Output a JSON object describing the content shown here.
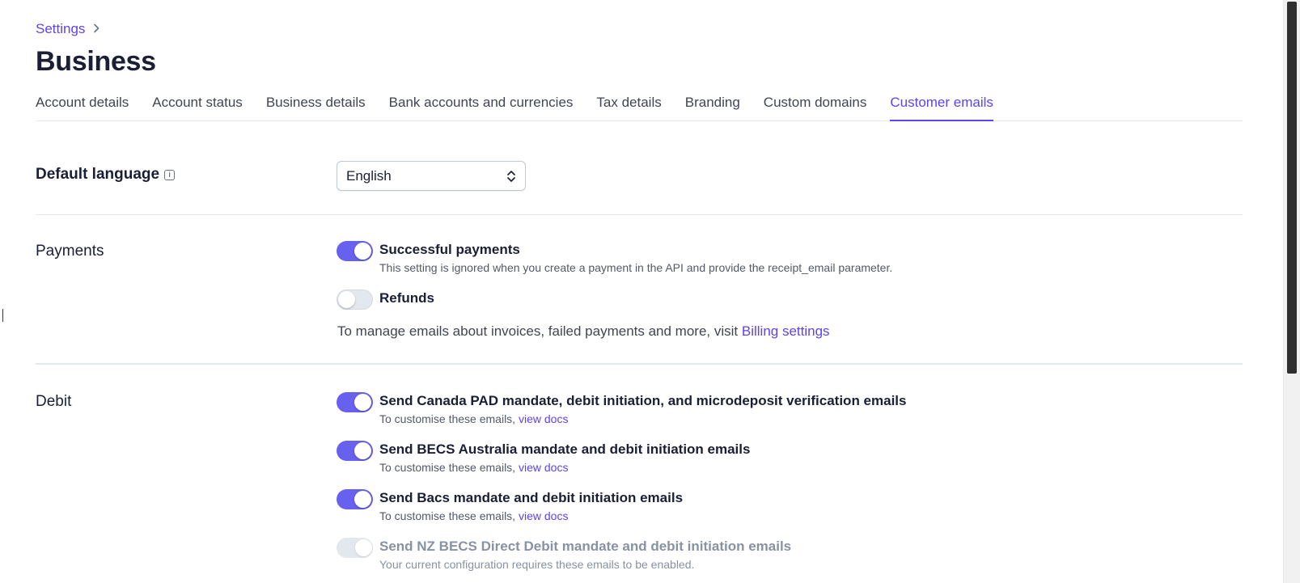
{
  "breadcrumb": {
    "link": "Settings",
    "sep_icon": "chevron-right-icon"
  },
  "page": {
    "title": "Business"
  },
  "tabs": [
    {
      "label": "Account details",
      "active": false
    },
    {
      "label": "Account status",
      "active": false
    },
    {
      "label": "Business details",
      "active": false
    },
    {
      "label": "Bank accounts and currencies",
      "active": false
    },
    {
      "label": "Tax details",
      "active": false
    },
    {
      "label": "Branding",
      "active": false
    },
    {
      "label": "Custom domains",
      "active": false
    },
    {
      "label": "Customer emails",
      "active": true
    }
  ],
  "default_language": {
    "label": "Default language",
    "info_icon": "info-icon",
    "selected": "English"
  },
  "payments": {
    "label": "Payments",
    "items": [
      {
        "title": "Successful payments",
        "desc": "This setting is ignored when you create a payment in the API and provide the receipt_email parameter.",
        "enabled": true
      },
      {
        "title": "Refunds",
        "desc": "",
        "enabled": false
      }
    ],
    "manage_text": "To manage emails about invoices, failed payments and more, visit ",
    "manage_link": "Billing settings"
  },
  "debit": {
    "label": "Debit",
    "items": [
      {
        "title": "Send Canada PAD mandate, debit initiation, and microdeposit verification emails",
        "desc": "To customise these emails, ",
        "link": "view docs",
        "enabled": true
      },
      {
        "title": "Send BECS Australia mandate and debit initiation emails",
        "desc": "To customise these emails, ",
        "link": "view docs",
        "enabled": true
      },
      {
        "title": "Send Bacs mandate and debit initiation emails",
        "desc": "To customise these emails, ",
        "link": "view docs",
        "enabled": true
      },
      {
        "title": "Send NZ BECS Direct Debit mandate and debit initiation emails",
        "desc": "Your current configuration requires these emails to be enabled.",
        "enabled": true,
        "disabled": true
      }
    ]
  },
  "colors": {
    "accent": "#5b44f2",
    "toggle_on": "#6860ef",
    "text": "#1a1f36",
    "muted": "#8792a2"
  }
}
